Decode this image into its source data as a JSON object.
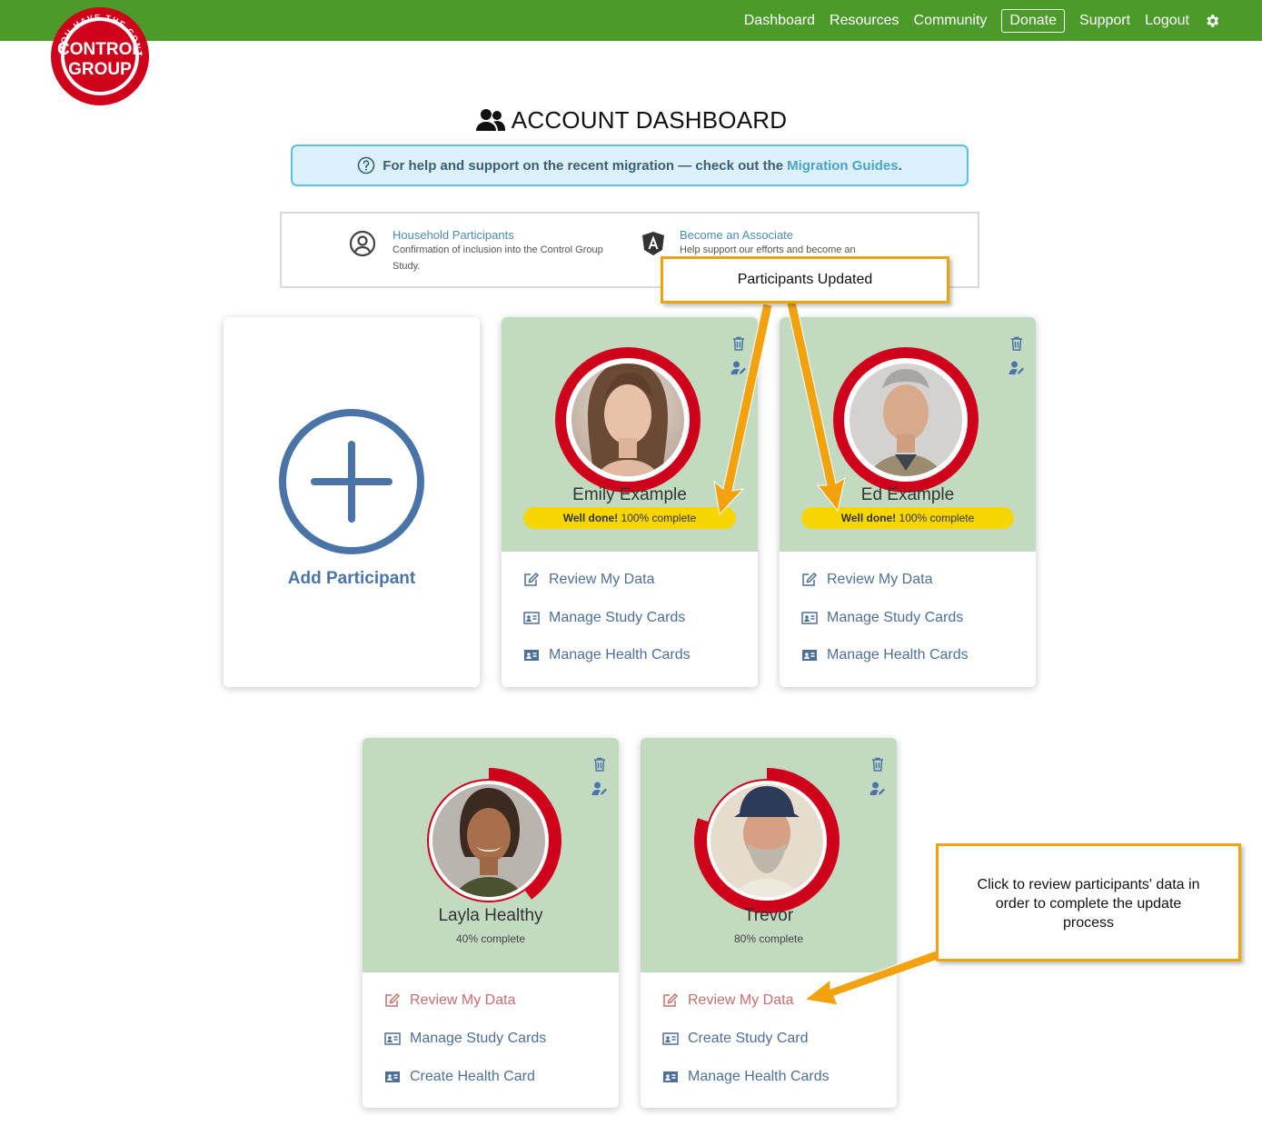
{
  "nav": {
    "items": [
      "Dashboard",
      "Resources",
      "Community"
    ],
    "donate": "Donate",
    "items_after": [
      "Support",
      "Logout"
    ]
  },
  "logo": {
    "line1": "CONTROL",
    "line2": "GROUP",
    "ring_text": "YOU HAVE THE CONTROL"
  },
  "page": {
    "title": "ACCOUNT DASHBOARD"
  },
  "banner": {
    "text": "For help and support on the recent migration — check out the",
    "link": "Migration Guides",
    "end": "."
  },
  "info": {
    "household_title": "Household Participants",
    "household_desc": "Confirmation of inclusion into the Control Group Study.",
    "associate_title": "Become an Associate",
    "associate_desc": "Help support our efforts and become an"
  },
  "add_card": {
    "label": "Add Participant"
  },
  "participants": [
    {
      "name": "Emily Example",
      "status_strong": "Well done!",
      "status_text": "100% complete",
      "progress": 1.0,
      "menu": [
        "Review My Data",
        "Manage Study Cards",
        "Manage Health Cards"
      ]
    },
    {
      "name": "Ed Example",
      "status_strong": "Well done!",
      "status_text": "100% complete",
      "progress": 1.0,
      "menu": [
        "Review My Data",
        "Manage Study Cards",
        "Manage Health Cards"
      ]
    },
    {
      "name": "Layla Healthy",
      "status_text": "40% complete",
      "progress": 0.4,
      "menu": [
        "Review My Data",
        "Manage Study Cards",
        "Create Health Card"
      ]
    },
    {
      "name": "Trevor",
      "status_text": "80% complete",
      "progress": 0.8,
      "menu": [
        "Review My Data",
        "Create Study Card",
        "Manage Health Cards"
      ]
    }
  ],
  "annotations": {
    "participants_updated": "Participants Updated",
    "click_review": "Click to review participants' data in order to complete the update process"
  },
  "colors": {
    "nav_green": "#4c9a2a",
    "card_green": "#c2dbc0",
    "ring_red": "#d0021b",
    "pill_yellow": "#f7d500",
    "link_blue": "#4d6f99",
    "warn_red": "#c96d6d",
    "callout_orange": "#f2a20f"
  }
}
